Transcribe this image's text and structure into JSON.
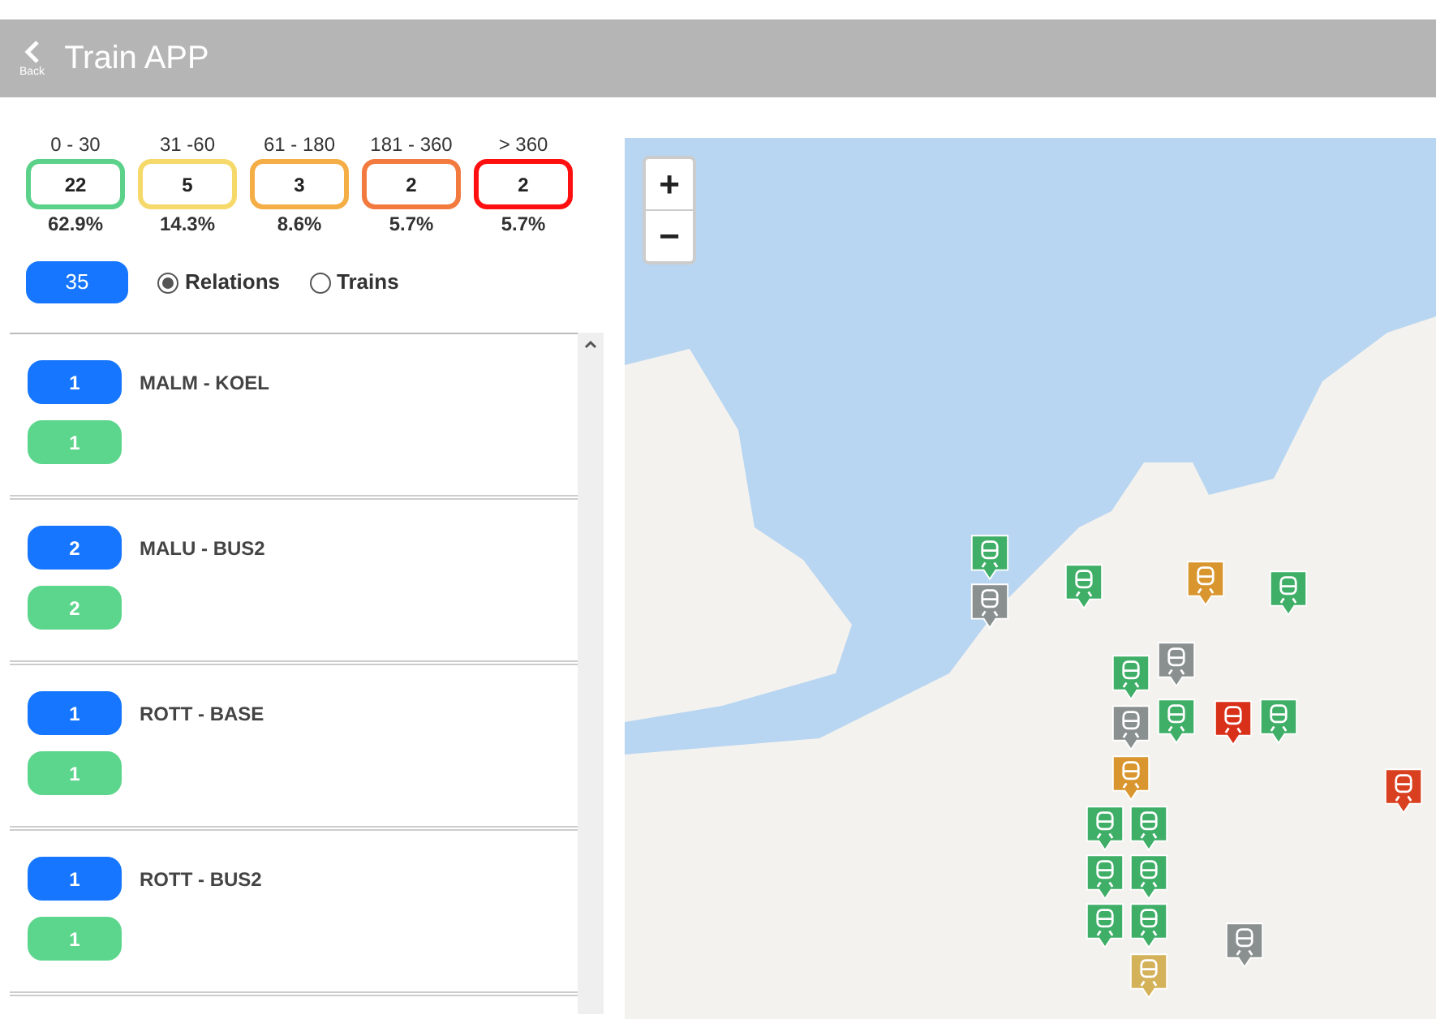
{
  "header": {
    "back_label": "Back",
    "title": "Train APP"
  },
  "buckets": [
    {
      "range": "0 - 30",
      "count": "22",
      "percent": "62.9%",
      "color": "#5cd18a"
    },
    {
      "range": "31 -60",
      "count": "5",
      "percent": "14.3%",
      "color": "#f5d96b"
    },
    {
      "range": "61 - 180",
      "count": "3",
      "percent": "8.6%",
      "color": "#f5ad45"
    },
    {
      "range": "181 - 360",
      "count": "2",
      "percent": "5.7%",
      "color": "#f27a3f"
    },
    {
      "range": "> 360",
      "count": "2",
      "percent": "5.7%",
      "color": "#ff0f0f"
    }
  ],
  "total": "35",
  "view_options": [
    {
      "label": "Relations",
      "selected": true
    },
    {
      "label": "Trains",
      "selected": false
    }
  ],
  "relations": [
    {
      "count": "1",
      "name": "MALM - KOEL",
      "on_time": "1"
    },
    {
      "count": "2",
      "name": "MALU - BUS2",
      "on_time": "2"
    },
    {
      "count": "1",
      "name": "ROTT - BASE",
      "on_time": "1"
    },
    {
      "count": "1",
      "name": "ROTT - BUS2",
      "on_time": "1"
    }
  ],
  "map": {
    "zoom_in": "+",
    "zoom_out": "−",
    "markers": [
      {
        "color": "#3fae67"
      },
      {
        "color": "#8a8f8f"
      },
      {
        "color": "#3fae67"
      },
      {
        "color": "#d9962e"
      },
      {
        "color": "#3fae67"
      },
      {
        "color": "#3fae67"
      },
      {
        "color": "#8a8f8f"
      },
      {
        "color": "#8a8f8f"
      },
      {
        "color": "#3fae67"
      },
      {
        "color": "#d9301a"
      },
      {
        "color": "#3fae67"
      },
      {
        "color": "#d9962e"
      },
      {
        "color": "#d9401f"
      },
      {
        "color": "#3fae67"
      },
      {
        "color": "#3fae67"
      },
      {
        "color": "#3fae67"
      },
      {
        "color": "#3fae67"
      },
      {
        "color": "#3fae67"
      },
      {
        "color": "#3fae67"
      },
      {
        "color": "#d4b25a"
      },
      {
        "color": "#8a8f8f"
      }
    ]
  }
}
